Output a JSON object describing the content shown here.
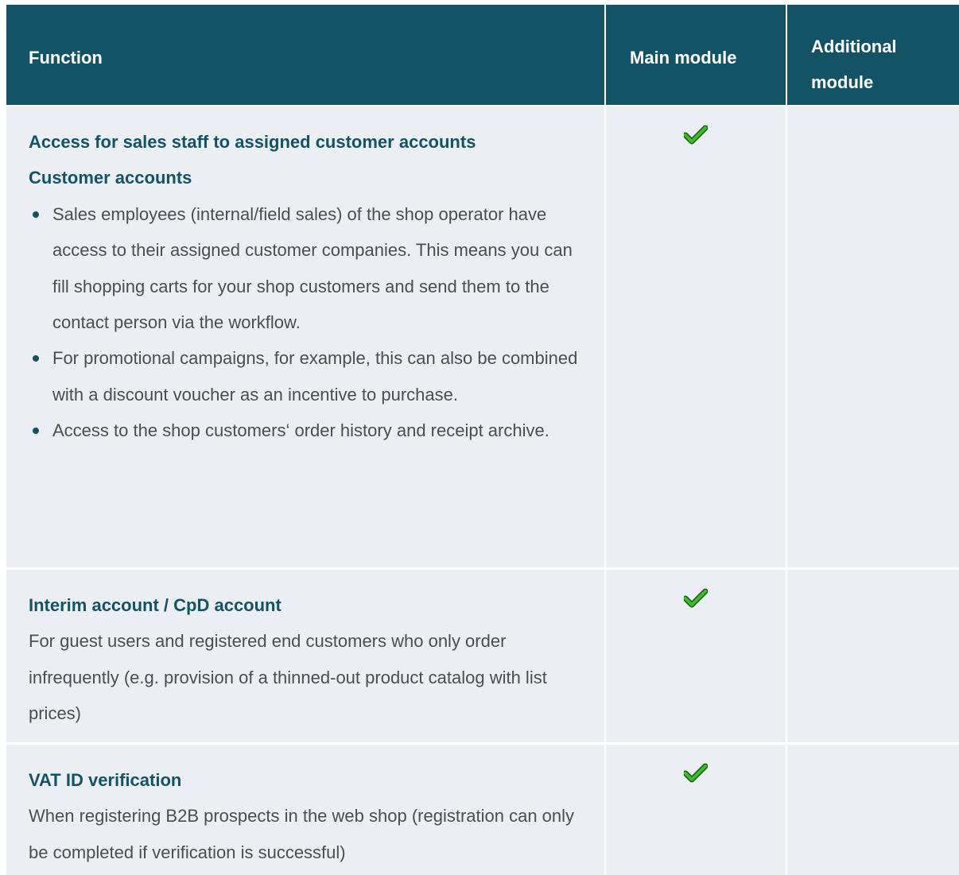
{
  "table": {
    "headers": {
      "function": "Function",
      "main": "Main module",
      "additional_line1": "Additional",
      "additional_line2": "module"
    },
    "rows": [
      {
        "headings": [
          "Access for sales staff to assigned customer accounts",
          "Customer accounts"
        ],
        "bullets": [
          "Sales employees (internal/field sales) of the shop operator have access to their assigned customer companies. This means you can fill shopping carts for your shop customers and send them to the contact person via the workflow.",
          "For promotional campaigns, for example, this can also be combined with a discount voucher as an incentive to purchase.",
          "Access to the shop customers‘ order history and receipt archive."
        ],
        "main_module": true,
        "additional_module": false
      },
      {
        "headings": [
          "Interim account / CpD account"
        ],
        "text": "For guest users and registered end customers who only order infrequently (e.g. provision of a thinned-out product catalog with list prices)",
        "main_module": true,
        "additional_module": false
      },
      {
        "headings": [
          "VAT ID verification"
        ],
        "text": "When registering B2B prospects in the web shop (registration can only be completed if verification is successful)",
        "main_module": true,
        "additional_module": false
      }
    ]
  },
  "icons": {
    "included": "check-icon"
  },
  "colors": {
    "header_bg": "#145266",
    "row_bg": "#ebeef2",
    "heading_text": "#145266",
    "body_text": "#4d4d4d",
    "check_green": "#3dbb2e"
  }
}
